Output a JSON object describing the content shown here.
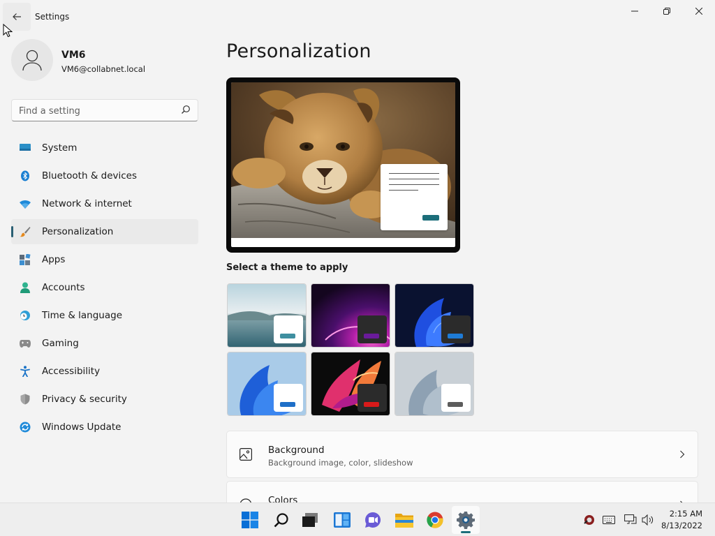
{
  "window": {
    "title": "Settings"
  },
  "user": {
    "name": "VM6",
    "email": "VM6@collabnet.local"
  },
  "search": {
    "placeholder": "Find a setting"
  },
  "sidebar": {
    "active": "Personalization",
    "items": [
      {
        "label": "System",
        "icon": "monitor-icon"
      },
      {
        "label": "Bluetooth & devices",
        "icon": "bluetooth-icon"
      },
      {
        "label": "Network & internet",
        "icon": "wifi-icon"
      },
      {
        "label": "Personalization",
        "icon": "paintbrush-icon"
      },
      {
        "label": "Apps",
        "icon": "apps-icon"
      },
      {
        "label": "Accounts",
        "icon": "person-icon"
      },
      {
        "label": "Time & language",
        "icon": "clock-globe-icon"
      },
      {
        "label": "Gaming",
        "icon": "gamepad-icon"
      },
      {
        "label": "Accessibility",
        "icon": "accessibility-icon"
      },
      {
        "label": "Privacy & security",
        "icon": "shield-icon"
      },
      {
        "label": "Windows Update",
        "icon": "update-icon"
      }
    ]
  },
  "main": {
    "title": "Personalization",
    "theme_heading": "Select a theme to apply",
    "themes": [
      {
        "name": "theme-lake",
        "accent": "#3f8fa0",
        "card": "#ffffff"
      },
      {
        "name": "theme-glow",
        "accent": "#6a1b9a",
        "card": "#2b2b2b"
      },
      {
        "name": "theme-bloom-dark",
        "accent": "#1e7bd6",
        "card": "#2b2b2b"
      },
      {
        "name": "theme-bloom-light",
        "accent": "#1e6fc8",
        "card": "#ffffff"
      },
      {
        "name": "theme-captured-motion",
        "accent": "#d91a1a",
        "card": "#2b2b2b"
      },
      {
        "name": "theme-flow",
        "accent": "#5c5c5c",
        "card": "#ffffff"
      }
    ],
    "settings": [
      {
        "title": "Background",
        "subtitle": "Background image, color, slideshow",
        "icon": "image-icon"
      },
      {
        "title": "Colors",
        "subtitle": "",
        "icon": "palette-icon"
      }
    ]
  },
  "taskbar": {
    "apps": [
      "start-icon",
      "search-icon",
      "task-view-icon",
      "widgets-icon",
      "chat-icon",
      "file-explorer-icon",
      "chrome-icon",
      "settings-icon"
    ],
    "active_app": "settings-icon",
    "time": "2:15 AM",
    "date": "8/13/2022"
  },
  "colors": {
    "accent": "#2a5f73",
    "background": "#f3f3f3"
  }
}
